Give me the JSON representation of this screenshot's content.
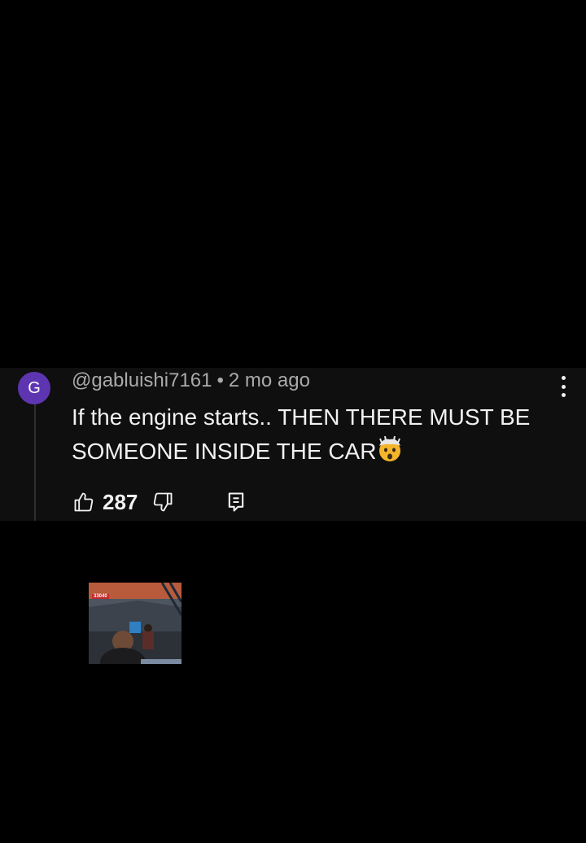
{
  "comment": {
    "avatar_letter": "G",
    "handle": "@gabluishi7161",
    "separator": "•",
    "time_ago": "2 mo ago",
    "text": "If the engine starts.. THEN THERE MUST BE SOMEONE INSIDE THE CAR",
    "emoji": "exploding-head-emoji",
    "likes": "287",
    "avatar_color": "#5e35b1"
  },
  "icons": {
    "more": "more-vertical-icon",
    "like": "thumbs-up-icon",
    "dislike": "thumbs-down-icon",
    "reply": "reply-comment-icon"
  },
  "thumbnail": {
    "badge": "33040"
  }
}
